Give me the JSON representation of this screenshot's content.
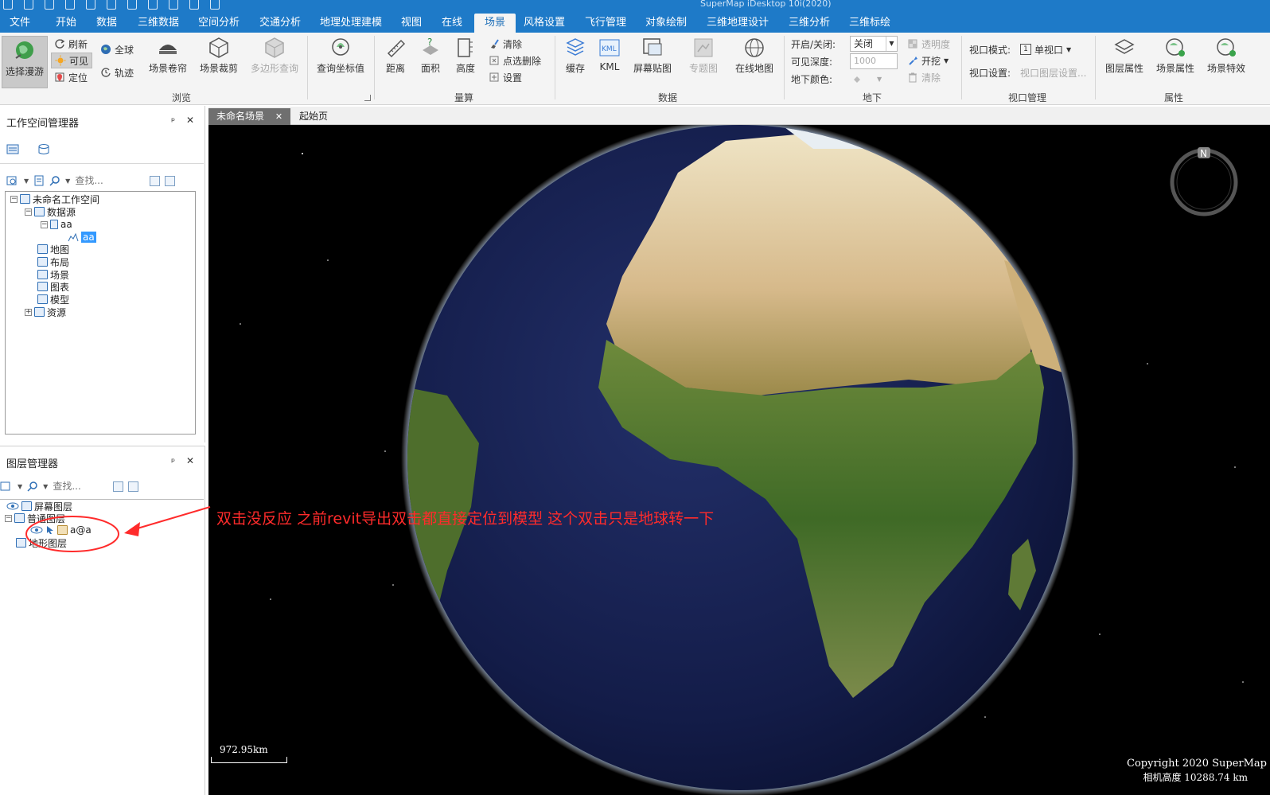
{
  "titlebar": {
    "title": "SuperMap iDesktop 10i(2020)"
  },
  "menu": {
    "tabs": [
      "文件",
      "开始",
      "数据",
      "三维数据",
      "空间分析",
      "交通分析",
      "地理处理建模",
      "视图",
      "在线",
      "场景",
      "风格设置",
      "飞行管理",
      "对象绘制",
      "三维地理设计",
      "三维分析",
      "三维标绘"
    ],
    "active": "场景"
  },
  "ribbon": {
    "browse": {
      "select_roam": "选择漫游",
      "refresh": "刷新",
      "visible": "可见",
      "locate": "定位",
      "globe": "全球",
      "track": "轨迹",
      "scene_curtain": "场景卷帘",
      "scene_clip": "场景裁剪",
      "polygon_query": "多边形查询",
      "query_coord": "查询坐标值",
      "group": "浏览"
    },
    "measure": {
      "distance": "距离",
      "area": "面积",
      "height": "高度",
      "clear": "清除",
      "point_delete": "点选删除",
      "settings": "设置",
      "group": "量算"
    },
    "data": {
      "cache": "缓存",
      "kml": "KML",
      "kml_icon_text": "KML",
      "screen_map": "屏幕贴图",
      "thematic": "专题图",
      "online_map": "在线地图",
      "group": "数据"
    },
    "underground": {
      "on_off_label": "开启/关闭:",
      "on_off_value": "关闭",
      "depth_label": "可见深度:",
      "depth_value": "1000",
      "color_label": "地下颜色:",
      "transparency": "透明度",
      "excavate": "开挖",
      "clear": "清除",
      "group": "地下"
    },
    "viewport": {
      "mode_label": "视口模式:",
      "mode_value": "单视口",
      "mode_icon_text": "1",
      "settings_label": "视口设置:",
      "settings_value": "视口图层设置...",
      "group": "视口管理"
    },
    "properties": {
      "layer_props": "图层属性",
      "scene_props": "场景属性",
      "scene_effects": "场景特效",
      "group": "属性"
    }
  },
  "workspace_panel": {
    "title": "工作空间管理器",
    "pin": "ᵖ",
    "close": "✕",
    "search_placeholder": "查找...",
    "tree": {
      "workspace": "未命名工作空间",
      "datasources": "数据源",
      "datasource_aa": "aa",
      "dataset_aa": "aa",
      "maps": "地图",
      "layouts": "布局",
      "scenes": "场景",
      "charts": "图表",
      "models": "模型",
      "resources": "资源"
    }
  },
  "layer_panel": {
    "title": "图层管理器",
    "pin": "ᵖ",
    "close": "✕",
    "search_placeholder": "查找...",
    "screen_layers": "屏幕图层",
    "normal_layers": "普通图层",
    "layer_item": "a@a",
    "terrain_layers": "地形图层"
  },
  "doc_tabs": {
    "active": "未命名场景",
    "close": "✕",
    "start_page": "起始页"
  },
  "scene": {
    "scale_label": "972.95km",
    "copyright": "Copyright 2020 SuperMap",
    "camera_height": "相机高度 10288.74 km",
    "compass_letter": "N"
  },
  "annotation": {
    "text": "双击没反应 之前revit导出双击都直接定位到模型 这个双击只是地球转一下",
    "color": "#ff2b2b"
  },
  "colors": {
    "accent": "#1e7ac8",
    "ribbon_bg": "#f4f4f4",
    "selection": "#3399ff",
    "annotation": "#ff2b2b"
  }
}
